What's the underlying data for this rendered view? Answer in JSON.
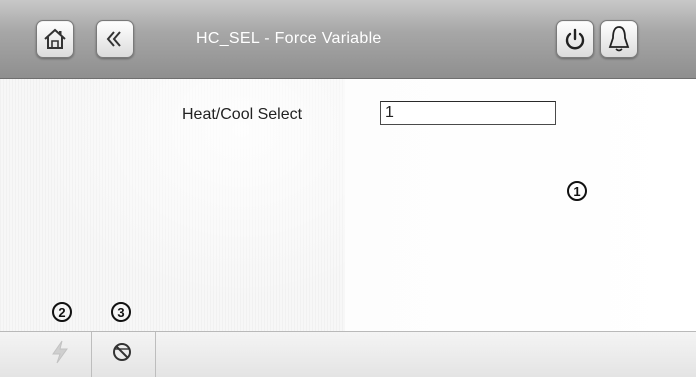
{
  "header": {
    "title": "HC_SEL - Force Variable",
    "home_icon": "home-icon",
    "back_icon": "back-icon",
    "power_icon": "power-icon",
    "alarm_icon": "bell-icon"
  },
  "form": {
    "label": "Heat/Cool Select",
    "value": "1"
  },
  "callouts": {
    "c1": "1",
    "c2": "2",
    "c3": "3"
  },
  "footer": {
    "force_icon": "lightning-icon",
    "cancel_icon": "no-symbol-icon"
  },
  "colors": {
    "header_bg": "#9e9e9e",
    "title_text": "#ffffff",
    "disabled_icon": "#c8c8c8"
  }
}
